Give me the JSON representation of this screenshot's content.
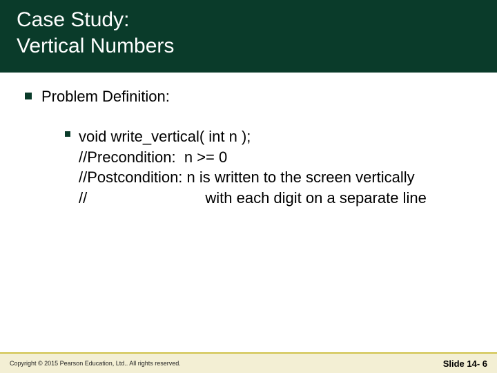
{
  "title": {
    "line1": "Case Study:",
    "line2": "Vertical Numbers"
  },
  "body": {
    "heading": "Problem Definition:",
    "code": "void write_vertical( int n );\n//Precondition:  n >= 0\n//Postcondition: n is written to the screen vertically\n//                            with each digit on a separate line"
  },
  "footer": {
    "copyright": "Copyright © 2015 Pearson Education, Ltd..  All rights reserved.",
    "slide_label": "Slide 14- 6"
  },
  "colors": {
    "title_bg": "#0a3b2a",
    "footer_border": "#d0c24a",
    "footer_bg": "#f3efd4"
  }
}
